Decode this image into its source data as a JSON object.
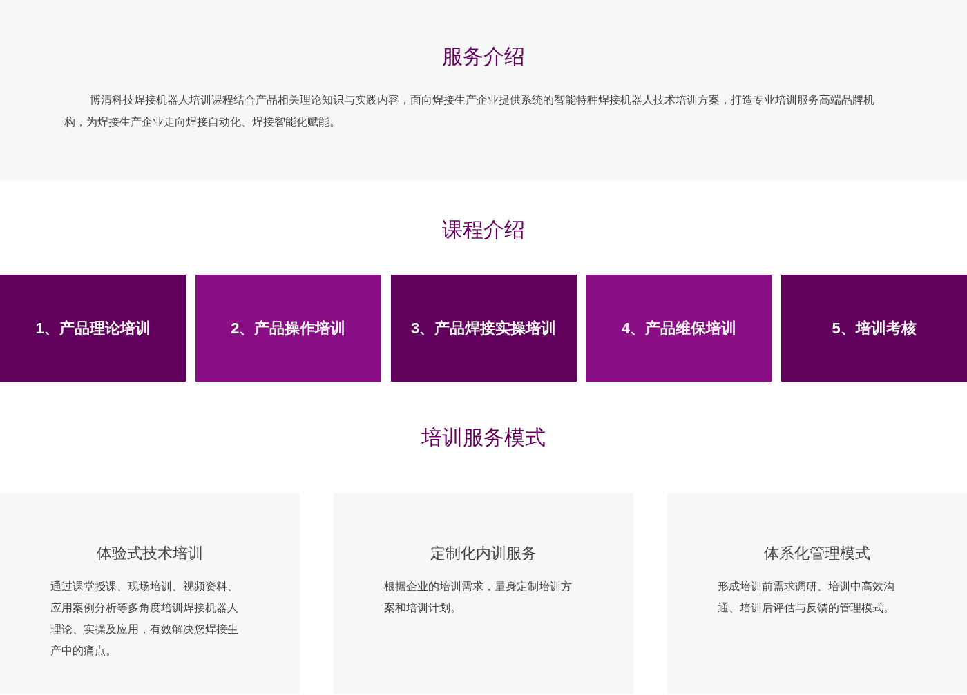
{
  "service_intro": {
    "title": "服务介绍",
    "text": "博清科技焊接机器人培训课程结合产品相关理论知识与实践内容，面向焊接生产企业提供系统的智能特种焊接机器人技术培训方案，打造专业培训服务高端品牌机构，为焊接生产企业走向焊接自动化、焊接智能化赋能。"
  },
  "course_intro": {
    "title": "课程介绍",
    "courses": [
      {
        "label": "1、产品理论培训",
        "color": "#62005e"
      },
      {
        "label": "2、产品操作培训",
        "color": "#8a0f86"
      },
      {
        "label": "3、产品焊接实操培训",
        "color": "#62005e"
      },
      {
        "label": "4、产品维保培训",
        "color": "#8a0f86"
      },
      {
        "label": "5、培训考核",
        "color": "#62005e"
      }
    ]
  },
  "service_modes": {
    "title": "培训服务模式",
    "cards": [
      {
        "title": "体验式技术培训",
        "text": "通过课堂授课、现场培训、视频资料、应用案例分析等多角度培训焊接机器人理论、实操及应用，有效解决您焊接生产中的痛点。"
      },
      {
        "title": "定制化内训服务",
        "text": "根据企业的培训需求，量身定制培训方案和培训计划。"
      },
      {
        "title": "体系化管理模式",
        "text": "形成培训前需求调研、培训中高效沟通、培训后评估与反馈的管理模式。"
      }
    ]
  }
}
